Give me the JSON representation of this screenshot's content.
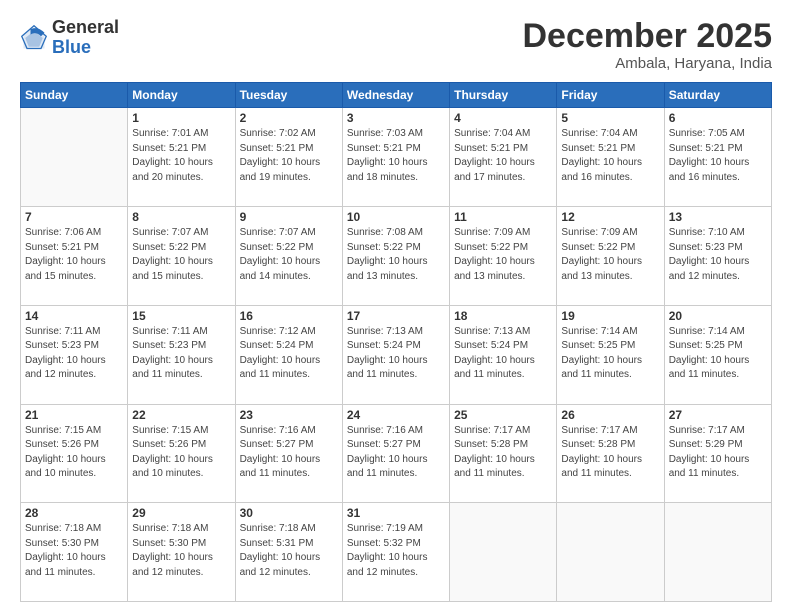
{
  "logo": {
    "general": "General",
    "blue": "Blue"
  },
  "header": {
    "month": "December 2025",
    "location": "Ambala, Haryana, India"
  },
  "days_of_week": [
    "Sunday",
    "Monday",
    "Tuesday",
    "Wednesday",
    "Thursday",
    "Friday",
    "Saturday"
  ],
  "weeks": [
    [
      {
        "day": "",
        "sunrise": "",
        "sunset": "",
        "daylight": ""
      },
      {
        "day": "1",
        "sunrise": "Sunrise: 7:01 AM",
        "sunset": "Sunset: 5:21 PM",
        "daylight": "Daylight: 10 hours and 20 minutes."
      },
      {
        "day": "2",
        "sunrise": "Sunrise: 7:02 AM",
        "sunset": "Sunset: 5:21 PM",
        "daylight": "Daylight: 10 hours and 19 minutes."
      },
      {
        "day": "3",
        "sunrise": "Sunrise: 7:03 AM",
        "sunset": "Sunset: 5:21 PM",
        "daylight": "Daylight: 10 hours and 18 minutes."
      },
      {
        "day": "4",
        "sunrise": "Sunrise: 7:04 AM",
        "sunset": "Sunset: 5:21 PM",
        "daylight": "Daylight: 10 hours and 17 minutes."
      },
      {
        "day": "5",
        "sunrise": "Sunrise: 7:04 AM",
        "sunset": "Sunset: 5:21 PM",
        "daylight": "Daylight: 10 hours and 16 minutes."
      },
      {
        "day": "6",
        "sunrise": "Sunrise: 7:05 AM",
        "sunset": "Sunset: 5:21 PM",
        "daylight": "Daylight: 10 hours and 16 minutes."
      }
    ],
    [
      {
        "day": "7",
        "sunrise": "Sunrise: 7:06 AM",
        "sunset": "Sunset: 5:21 PM",
        "daylight": "Daylight: 10 hours and 15 minutes."
      },
      {
        "day": "8",
        "sunrise": "Sunrise: 7:07 AM",
        "sunset": "Sunset: 5:22 PM",
        "daylight": "Daylight: 10 hours and 15 minutes."
      },
      {
        "day": "9",
        "sunrise": "Sunrise: 7:07 AM",
        "sunset": "Sunset: 5:22 PM",
        "daylight": "Daylight: 10 hours and 14 minutes."
      },
      {
        "day": "10",
        "sunrise": "Sunrise: 7:08 AM",
        "sunset": "Sunset: 5:22 PM",
        "daylight": "Daylight: 10 hours and 13 minutes."
      },
      {
        "day": "11",
        "sunrise": "Sunrise: 7:09 AM",
        "sunset": "Sunset: 5:22 PM",
        "daylight": "Daylight: 10 hours and 13 minutes."
      },
      {
        "day": "12",
        "sunrise": "Sunrise: 7:09 AM",
        "sunset": "Sunset: 5:22 PM",
        "daylight": "Daylight: 10 hours and 13 minutes."
      },
      {
        "day": "13",
        "sunrise": "Sunrise: 7:10 AM",
        "sunset": "Sunset: 5:23 PM",
        "daylight": "Daylight: 10 hours and 12 minutes."
      }
    ],
    [
      {
        "day": "14",
        "sunrise": "Sunrise: 7:11 AM",
        "sunset": "Sunset: 5:23 PM",
        "daylight": "Daylight: 10 hours and 12 minutes."
      },
      {
        "day": "15",
        "sunrise": "Sunrise: 7:11 AM",
        "sunset": "Sunset: 5:23 PM",
        "daylight": "Daylight: 10 hours and 11 minutes."
      },
      {
        "day": "16",
        "sunrise": "Sunrise: 7:12 AM",
        "sunset": "Sunset: 5:24 PM",
        "daylight": "Daylight: 10 hours and 11 minutes."
      },
      {
        "day": "17",
        "sunrise": "Sunrise: 7:13 AM",
        "sunset": "Sunset: 5:24 PM",
        "daylight": "Daylight: 10 hours and 11 minutes."
      },
      {
        "day": "18",
        "sunrise": "Sunrise: 7:13 AM",
        "sunset": "Sunset: 5:24 PM",
        "daylight": "Daylight: 10 hours and 11 minutes."
      },
      {
        "day": "19",
        "sunrise": "Sunrise: 7:14 AM",
        "sunset": "Sunset: 5:25 PM",
        "daylight": "Daylight: 10 hours and 11 minutes."
      },
      {
        "day": "20",
        "sunrise": "Sunrise: 7:14 AM",
        "sunset": "Sunset: 5:25 PM",
        "daylight": "Daylight: 10 hours and 11 minutes."
      }
    ],
    [
      {
        "day": "21",
        "sunrise": "Sunrise: 7:15 AM",
        "sunset": "Sunset: 5:26 PM",
        "daylight": "Daylight: 10 hours and 10 minutes."
      },
      {
        "day": "22",
        "sunrise": "Sunrise: 7:15 AM",
        "sunset": "Sunset: 5:26 PM",
        "daylight": "Daylight: 10 hours and 10 minutes."
      },
      {
        "day": "23",
        "sunrise": "Sunrise: 7:16 AM",
        "sunset": "Sunset: 5:27 PM",
        "daylight": "Daylight: 10 hours and 11 minutes."
      },
      {
        "day": "24",
        "sunrise": "Sunrise: 7:16 AM",
        "sunset": "Sunset: 5:27 PM",
        "daylight": "Daylight: 10 hours and 11 minutes."
      },
      {
        "day": "25",
        "sunrise": "Sunrise: 7:17 AM",
        "sunset": "Sunset: 5:28 PM",
        "daylight": "Daylight: 10 hours and 11 minutes."
      },
      {
        "day": "26",
        "sunrise": "Sunrise: 7:17 AM",
        "sunset": "Sunset: 5:28 PM",
        "daylight": "Daylight: 10 hours and 11 minutes."
      },
      {
        "day": "27",
        "sunrise": "Sunrise: 7:17 AM",
        "sunset": "Sunset: 5:29 PM",
        "daylight": "Daylight: 10 hours and 11 minutes."
      }
    ],
    [
      {
        "day": "28",
        "sunrise": "Sunrise: 7:18 AM",
        "sunset": "Sunset: 5:30 PM",
        "daylight": "Daylight: 10 hours and 11 minutes."
      },
      {
        "day": "29",
        "sunrise": "Sunrise: 7:18 AM",
        "sunset": "Sunset: 5:30 PM",
        "daylight": "Daylight: 10 hours and 12 minutes."
      },
      {
        "day": "30",
        "sunrise": "Sunrise: 7:18 AM",
        "sunset": "Sunset: 5:31 PM",
        "daylight": "Daylight: 10 hours and 12 minutes."
      },
      {
        "day": "31",
        "sunrise": "Sunrise: 7:19 AM",
        "sunset": "Sunset: 5:32 PM",
        "daylight": "Daylight: 10 hours and 12 minutes."
      },
      {
        "day": "",
        "sunrise": "",
        "sunset": "",
        "daylight": ""
      },
      {
        "day": "",
        "sunrise": "",
        "sunset": "",
        "daylight": ""
      },
      {
        "day": "",
        "sunrise": "",
        "sunset": "",
        "daylight": ""
      }
    ]
  ]
}
